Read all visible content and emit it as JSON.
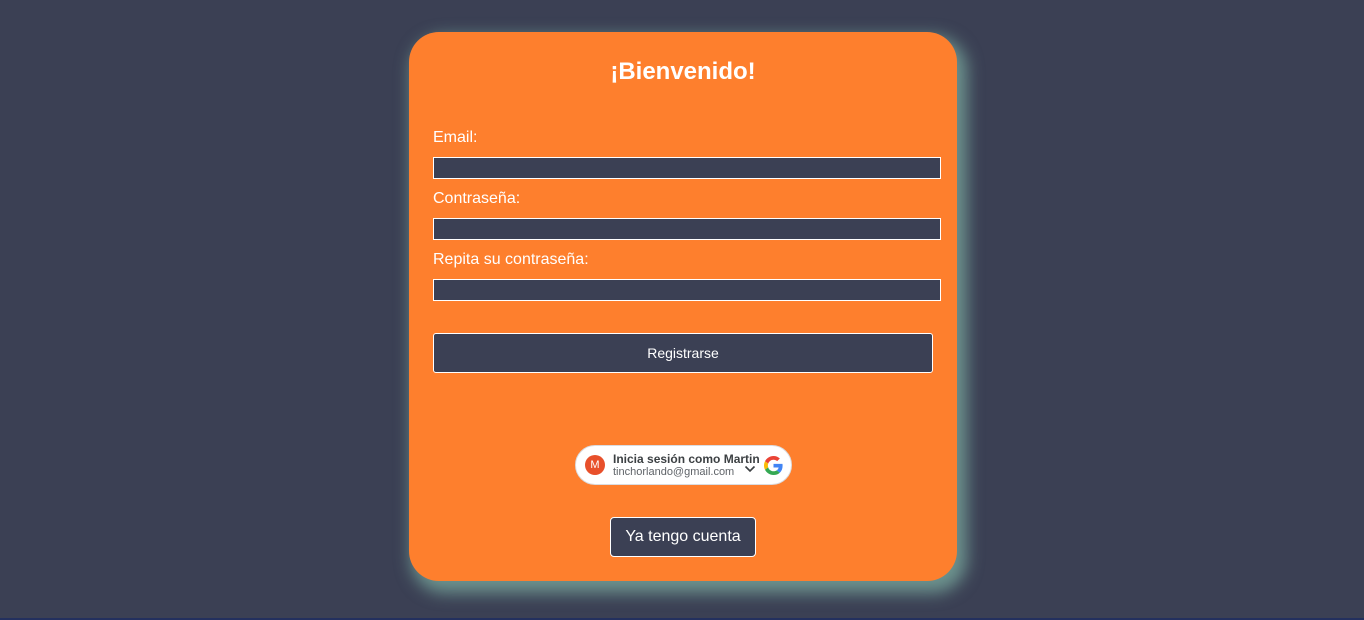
{
  "form": {
    "title": "¡Bienvenido!",
    "email_label": "Email:",
    "email_value": "",
    "password_label": "Contraseña:",
    "password_value": "",
    "repeat_password_label": "Repita su contraseña:",
    "repeat_password_value": "",
    "register_label": "Registrarse"
  },
  "google_signin": {
    "avatar_initial": "M",
    "prompt": "Inicia sesión como Martin",
    "email": "tinchorlando@gmail.com",
    "logo_icon": "google-logo-icon",
    "chevron_icon": "chevron-down-icon"
  },
  "footer": {
    "login_label": "Ya tengo cuenta"
  },
  "colors": {
    "background": "#3b4054",
    "card": "#fe7f2d",
    "card_glow": "#96d7be",
    "input_background": "#3b4054",
    "text": "#ffffff"
  }
}
